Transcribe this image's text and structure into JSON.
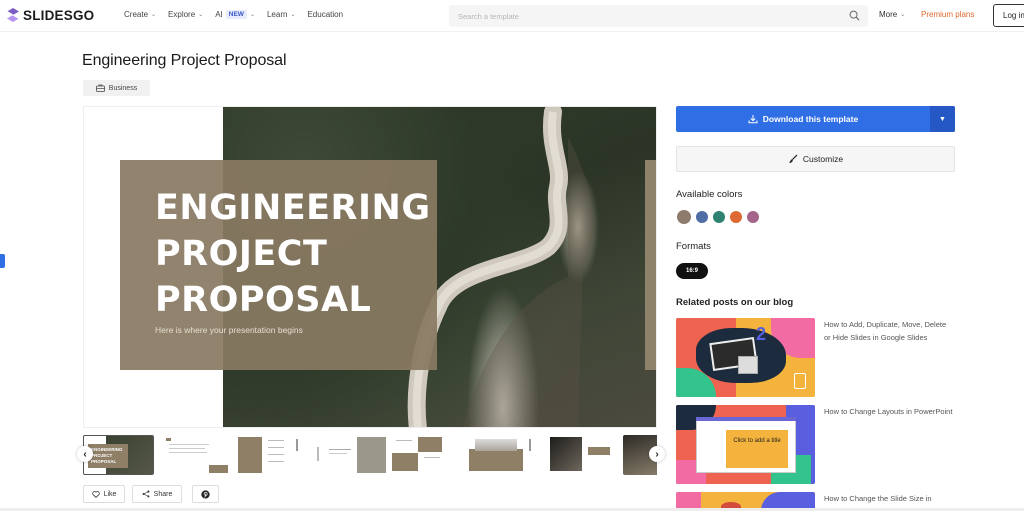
{
  "header": {
    "brand": "SLIDESGO",
    "nav": [
      {
        "label": "Create",
        "has_dropdown": true
      },
      {
        "label": "Explore",
        "has_dropdown": true
      },
      {
        "label": "AI",
        "badge": "NEW",
        "has_dropdown": true
      },
      {
        "label": "Learn",
        "has_dropdown": true
      },
      {
        "label": "Education",
        "has_dropdown": false
      }
    ],
    "search": {
      "placeholder": "Search a template",
      "value": "",
      "icon": "search-icon"
    },
    "more_label": "More",
    "premium_label": "Premium plans",
    "login_label": "Log in",
    "accent_color": "#2f6ee5",
    "premium_color": "#e0672e"
  },
  "template": {
    "title": "Engineering Project Proposal",
    "category_tag": {
      "label": "Business",
      "icon": "briefcase-icon"
    },
    "preview": {
      "slide_title_lines": [
        "ENGINEERING",
        "PROJECT",
        "PROPOSAL"
      ],
      "slide_subtitle": "Here is where your presentation begins"
    },
    "thumbnails": [
      {
        "index": 1,
        "active": true,
        "label": "ENGINEERING PROJECT PROPOSAL"
      },
      {
        "index": 2,
        "active": false
      },
      {
        "index": 3,
        "active": false
      },
      {
        "index": 4,
        "active": false
      },
      {
        "index": 5,
        "active": false
      },
      {
        "index": 6,
        "active": false
      },
      {
        "index": 7,
        "active": false
      },
      {
        "index": 8,
        "active": false
      },
      {
        "index": 9,
        "active": false
      }
    ],
    "actions": {
      "like_label": "Like",
      "share_label": "Share",
      "pinterest_icon": "pinterest-icon"
    }
  },
  "sidebar": {
    "download_label": "Download this template",
    "customize_label": "Customize",
    "available_colors_heading": "Available colors",
    "colors": [
      "#8e7b6c",
      "#4f6ea6",
      "#2f8272",
      "#dd6a35",
      "#a56489"
    ],
    "formats_heading": "Formats",
    "formats": [
      "16:9"
    ],
    "related_heading": "Related posts on our blog",
    "related_posts": [
      {
        "title": "How to Add, Duplicate, Move, Delete or Hide Slides in Google Slides"
      },
      {
        "title": "How to Change Layouts in PowerPoint",
        "image_caption": "Click to add a title"
      },
      {
        "title": "How to Change the Slide Size in"
      }
    ]
  }
}
